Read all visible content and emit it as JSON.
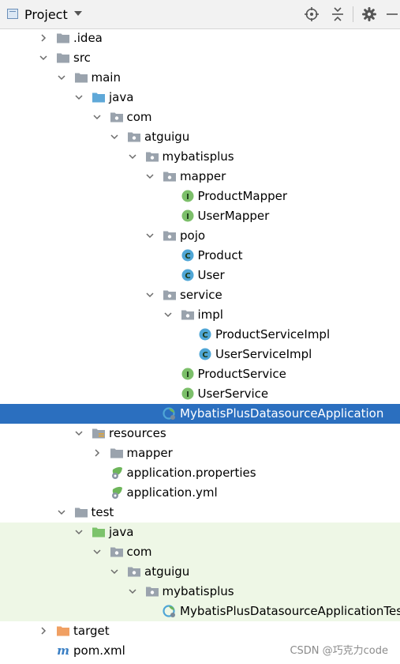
{
  "header": {
    "title": "Project",
    "icons": [
      "project-view-icon",
      "crosshair-icon",
      "collapse-all-icon",
      "gear-icon",
      "minimize-icon"
    ]
  },
  "colors": {
    "selection": "#2b6fbf",
    "test_background": "#eef7e6",
    "folder": "#9aa3ad",
    "source_folder": "#5fa8d8",
    "test_folder": "#7cc36b",
    "target_folder": "#f0a063",
    "interface_badge": "#7cbf6a",
    "class_badge": "#4fa6d6"
  },
  "tree": {
    "rows": [
      {
        "label": ".idea",
        "depth": 0,
        "arrow": "right",
        "icon": "folder-icon"
      },
      {
        "label": "src",
        "depth": 0,
        "arrow": "down",
        "icon": "folder-icon"
      },
      {
        "label": "main",
        "depth": 1,
        "arrow": "down",
        "icon": "folder-icon"
      },
      {
        "label": "java",
        "depth": 2,
        "arrow": "down",
        "icon": "source-folder-icon"
      },
      {
        "label": "com",
        "depth": 3,
        "arrow": "down",
        "icon": "package-icon"
      },
      {
        "label": "atguigu",
        "depth": 4,
        "arrow": "down",
        "icon": "package-icon"
      },
      {
        "label": "mybatisplus",
        "depth": 5,
        "arrow": "down",
        "icon": "package-icon"
      },
      {
        "label": "mapper",
        "depth": 6,
        "arrow": "down",
        "icon": "package-icon"
      },
      {
        "label": "ProductMapper",
        "depth": 7,
        "arrow": "",
        "icon": "interface-icon"
      },
      {
        "label": "UserMapper",
        "depth": 7,
        "arrow": "",
        "icon": "interface-icon"
      },
      {
        "label": "pojo",
        "depth": 6,
        "arrow": "down",
        "icon": "package-icon"
      },
      {
        "label": "Product",
        "depth": 7,
        "arrow": "",
        "icon": "class-icon"
      },
      {
        "label": "User",
        "depth": 7,
        "arrow": "",
        "icon": "class-icon"
      },
      {
        "label": "service",
        "depth": 6,
        "arrow": "down",
        "icon": "package-icon"
      },
      {
        "label": "impl",
        "depth": 7,
        "arrow": "down",
        "icon": "package-icon"
      },
      {
        "label": "ProductServiceImpl",
        "depth": 8,
        "arrow": "",
        "icon": "class-icon"
      },
      {
        "label": "UserServiceImpl",
        "depth": 8,
        "arrow": "",
        "icon": "class-icon"
      },
      {
        "label": "ProductService",
        "depth": 7,
        "arrow": "",
        "icon": "interface-icon"
      },
      {
        "label": "UserService",
        "depth": 7,
        "arrow": "",
        "icon": "interface-icon"
      },
      {
        "label": "MybatisPlusDatasourceApplication",
        "depth": 6,
        "arrow": "",
        "icon": "spring-app-icon",
        "selected": true
      },
      {
        "label": "resources",
        "depth": 2,
        "arrow": "down",
        "icon": "resources-folder-icon"
      },
      {
        "label": "mapper",
        "depth": 3,
        "arrow": "right",
        "icon": "folder-icon"
      },
      {
        "label": "application.properties",
        "depth": 3,
        "arrow": "",
        "icon": "spring-config-icon"
      },
      {
        "label": "application.yml",
        "depth": 3,
        "arrow": "",
        "icon": "spring-config-icon"
      },
      {
        "label": "test",
        "depth": 1,
        "arrow": "down",
        "icon": "folder-icon"
      },
      {
        "label": "java",
        "depth": 2,
        "arrow": "down",
        "icon": "test-folder-icon",
        "test": true
      },
      {
        "label": "com",
        "depth": 3,
        "arrow": "down",
        "icon": "package-icon",
        "test": true
      },
      {
        "label": "atguigu",
        "depth": 4,
        "arrow": "down",
        "icon": "package-icon",
        "test": true
      },
      {
        "label": "mybatisplus",
        "depth": 5,
        "arrow": "down",
        "icon": "package-icon",
        "test": true
      },
      {
        "label": "MybatisPlusDatasourceApplicationTes",
        "depth": 6,
        "arrow": "",
        "icon": "spring-test-icon",
        "test": true
      },
      {
        "label": "target",
        "depth": 0,
        "arrow": "right",
        "icon": "target-folder-icon",
        "excluded": true
      },
      {
        "label": "pom.xml",
        "depth": 0,
        "arrow": "",
        "icon": "maven-icon"
      }
    ]
  },
  "watermark": "CSDN @巧克力code"
}
